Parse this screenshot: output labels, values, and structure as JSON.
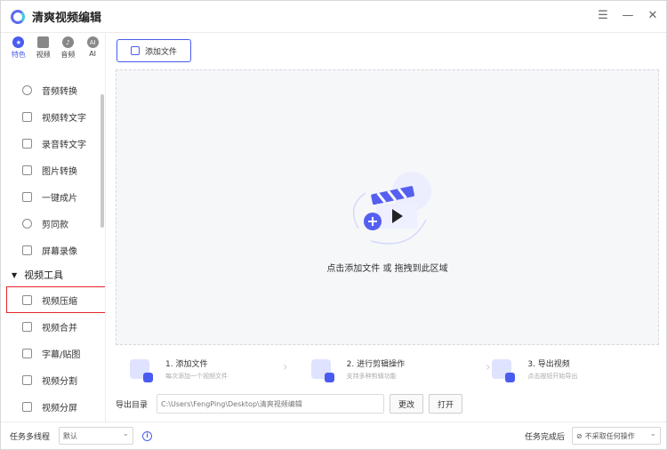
{
  "app": {
    "title": "清爽视频编辑"
  },
  "window_controls": [
    {
      "name": "menu-icon",
      "glyph": "☰"
    },
    {
      "name": "minimize-icon",
      "glyph": "—"
    },
    {
      "name": "close-icon",
      "glyph": "✕"
    }
  ],
  "sidebar": {
    "tabs": [
      {
        "label": "特色",
        "icon": "star-icon",
        "glyph": "★",
        "active": true
      },
      {
        "label": "视频",
        "icon": "video-icon",
        "glyph": "",
        "active": false
      },
      {
        "label": "音频",
        "icon": "music-icon",
        "glyph": "♪",
        "active": false
      },
      {
        "label": "AI",
        "icon": "ai-icon",
        "glyph": "AI",
        "active": false
      }
    ],
    "items": [
      {
        "label": "音频转换",
        "icon": "microphone-icon"
      },
      {
        "label": "视频转文字",
        "icon": "video-text-icon"
      },
      {
        "label": "录音转文字",
        "icon": "audio-text-icon"
      },
      {
        "label": "图片转换",
        "icon": "image-icon"
      },
      {
        "label": "一键成片",
        "icon": "magic-icon"
      },
      {
        "label": "剪同款",
        "icon": "template-icon"
      },
      {
        "label": "屏幕录像",
        "icon": "screen-record-icon"
      }
    ],
    "section": "视频工具",
    "section_items": [
      {
        "label": "视频压缩",
        "icon": "compress-icon",
        "selected": true
      },
      {
        "label": "视频合并",
        "icon": "merge-icon"
      },
      {
        "label": "字幕/贴图",
        "icon": "subtitle-icon"
      },
      {
        "label": "视频分割",
        "icon": "split-icon"
      },
      {
        "label": "视频分屏",
        "icon": "split-screen-icon"
      }
    ]
  },
  "main": {
    "add_file": "添加文件",
    "drop_text": "点击添加文件 或 拖拽到此区域",
    "steps": [
      {
        "title": "1. 添加文件",
        "subtitle": "每次添加一个视频文件"
      },
      {
        "title": "2. 进行剪辑操作",
        "subtitle": "支持多种剪辑功能"
      },
      {
        "title": "3. 导出视频",
        "subtitle": "点击按钮开始导出"
      }
    ],
    "export": {
      "label": "导出目录",
      "path": "C:\\Users\\FengPing\\Desktop\\清爽视频编辑",
      "change": "更改",
      "open": "打开"
    }
  },
  "bottom": {
    "threads_label": "任务多线程",
    "threads_value": "默认",
    "after_label": "任务完成后",
    "after_value": "不采取任何操作"
  },
  "colors": {
    "accent": "#4a5cf0",
    "highlight": "#e3252b"
  }
}
